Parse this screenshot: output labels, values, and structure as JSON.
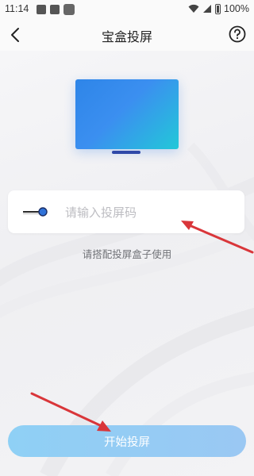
{
  "status_bar": {
    "time": "11:14",
    "battery": "100%",
    "icons": [
      "image-icon",
      "font-icon",
      "app-icon",
      "wifi-icon",
      "signal-icon",
      "battery-icon"
    ]
  },
  "header": {
    "title": "宝盒投屏",
    "back_icon": "chevron-left-icon",
    "help_icon": "help-circle-icon"
  },
  "main": {
    "tv_icon": "tv-screen-icon",
    "cast_icon": "cast-toggle-icon",
    "input": {
      "value": "",
      "placeholder": "请输入投屏码"
    },
    "hint": "请搭配投屏盒子使用",
    "start_button": "开始投屏"
  },
  "overlays": {
    "arrows": [
      "red-arrow-to-input",
      "red-arrow-to-button"
    ],
    "color": "#d9363a"
  },
  "colors": {
    "button_gradient_start": "#8fd0f5",
    "button_gradient_end": "#9ac8f3",
    "tv_blue": "#2e85e8",
    "tv_cyan": "#22c8d8"
  }
}
